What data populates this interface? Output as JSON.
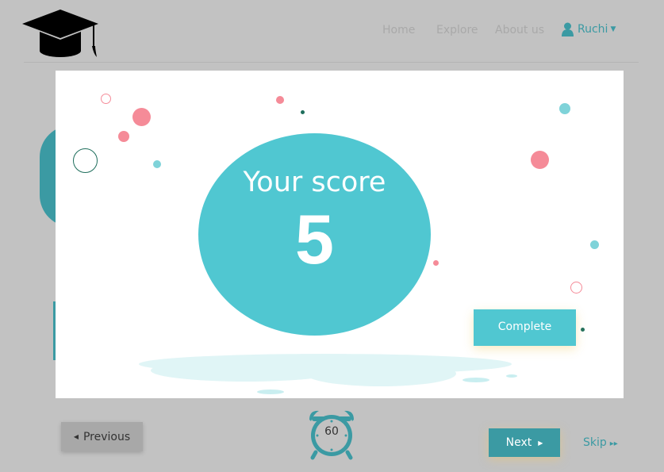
{
  "header": {
    "nav": {
      "home": "Home",
      "explore": "Explore",
      "about": "About us"
    },
    "user": {
      "name": "Ruchi",
      "avatar_icon": "user-icon",
      "caret_icon": "caret-down-icon"
    },
    "logo_icon": "graduation-cap-icon"
  },
  "modal": {
    "title": "Your score",
    "score": "5",
    "complete_label": "Complete"
  },
  "footer": {
    "previous_label": "Previous",
    "timer_value": "60",
    "next_label": "Next",
    "skip_label": "Skip"
  },
  "colors": {
    "accent": "#50c7d1",
    "accent_dark": "#3b9aa3",
    "pink": "#f58b98",
    "dark_green": "#1e6e5c",
    "overlay": "#c2c2c2"
  }
}
